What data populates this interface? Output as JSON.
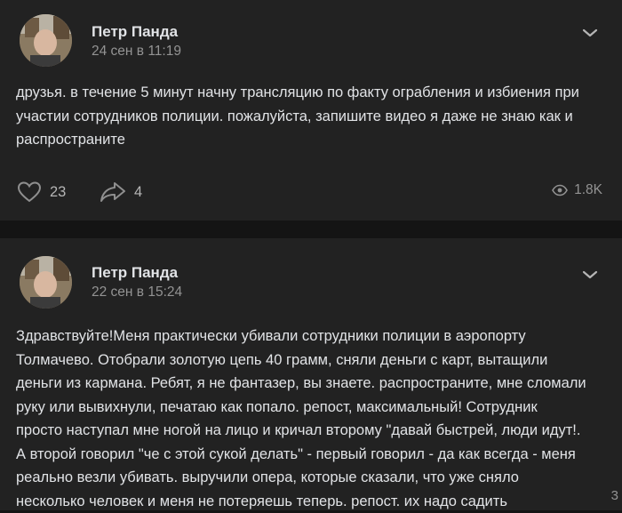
{
  "posts": [
    {
      "author": "Петр Панда",
      "date": "24 сен в 11:19",
      "lines": [
        "друзья. в течение 5 минут начну трансляцию по факту ограбления и избиения при",
        "участии сотрудников полиции. пожалуйста, запишите видео я даже не знаю как и",
        "распространите"
      ],
      "likes": "23",
      "shares": "4",
      "views": "1.8K"
    },
    {
      "author": "Петр Панда",
      "date": "22 сен в 15:24",
      "lines": [
        "Здравствуйте!Меня практически убивали сотрудники полиции в аэропорту",
        "Толмачево. Отобрали золотую цепь 40 грамм, сняли деньги с карт, вытащили",
        "деньги из кармана. Ребят, я не фантазер, вы знаете. распространите, мне сломали",
        "руку или вывихнули, печатаю как попало. репост, максимальный! Сотрудник",
        "просто наступал мне ногой на лицо и кричал второму \"давай быстрей, люди идут!.",
        "А второй говорил \"че с этой сукой делать\" - первый говорил - да как всегда - меня",
        "реально везли убивать. выручили опера, которые сказали, что уже сняло",
        "несколько человек и меня не потеряешь теперь. репост. их надо садить"
      ],
      "corner_count": "3"
    }
  ],
  "icons": {
    "like": "heart-icon",
    "share": "share-arrow-icon",
    "views": "eye-icon",
    "menu": "chevron-down-icon"
  },
  "colors": {
    "background": "#141414",
    "card": "#222222",
    "text": "#e1e3e6",
    "secondary": "#939393"
  }
}
